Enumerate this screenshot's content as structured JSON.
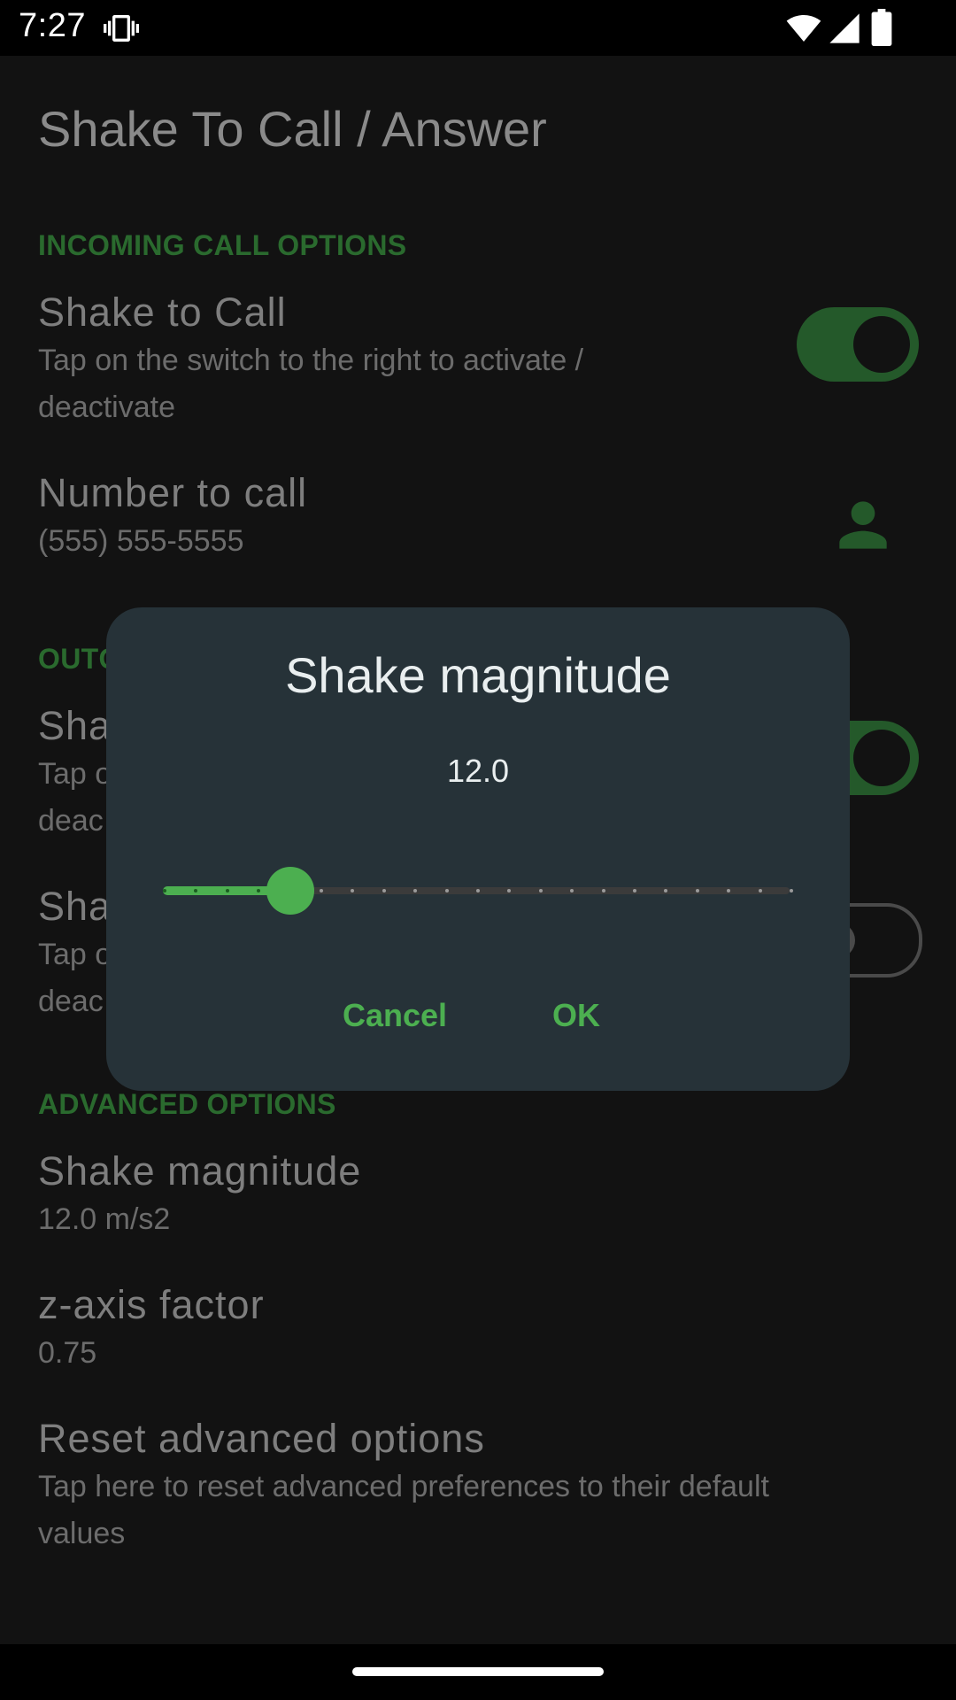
{
  "status_bar": {
    "time": "7:27",
    "icons": [
      "vibrate-icon",
      "wifi-icon",
      "signal-icon",
      "battery-icon"
    ]
  },
  "app": {
    "title": "Shake To Call / Answer",
    "sections": {
      "incoming": {
        "header": "INCOMING CALL OPTIONS"
      },
      "outgoing": {
        "header_visible": "OUTG"
      },
      "advanced": {
        "header": "ADVANCED OPTIONS"
      }
    },
    "preferences": {
      "shake_to_call": {
        "title": "Shake to Call",
        "summary_line1": "Tap on the switch to the right to activate /",
        "summary_line2": "deactivate",
        "enabled": true
      },
      "number_to_call": {
        "title": "Number to call",
        "summary": "(555) 555-5555",
        "icon": "contact-icon"
      },
      "outgoing_pref_1": {
        "title_visible": "Sha",
        "summary_line1_visible": "Tap o",
        "summary_line2_visible": "deac",
        "enabled": true
      },
      "outgoing_pref_2": {
        "title_visible": "Sha",
        "summary_line1_visible": "Tap o",
        "summary_line2_visible": "deac",
        "enabled": false
      },
      "shake_magnitude": {
        "title": "Shake magnitude",
        "summary": "12.0 m/s2"
      },
      "z_axis_factor": {
        "title": "z-axis factor",
        "summary": "0.75"
      },
      "reset_advanced": {
        "title": "Reset advanced options",
        "summary_line1": "Tap here to reset advanced preferences to their default",
        "summary_line2": "values"
      }
    }
  },
  "dialog": {
    "title": "Shake magnitude",
    "value": "12.0",
    "slider": {
      "tick_count": 21,
      "selected_index": 4,
      "fraction": 0.2
    },
    "cancel_label": "Cancel",
    "ok_label": "OK"
  },
  "colors": {
    "accent": "#4caf50",
    "dialog_bg": "#263238",
    "scrim_bg": "#121212"
  }
}
